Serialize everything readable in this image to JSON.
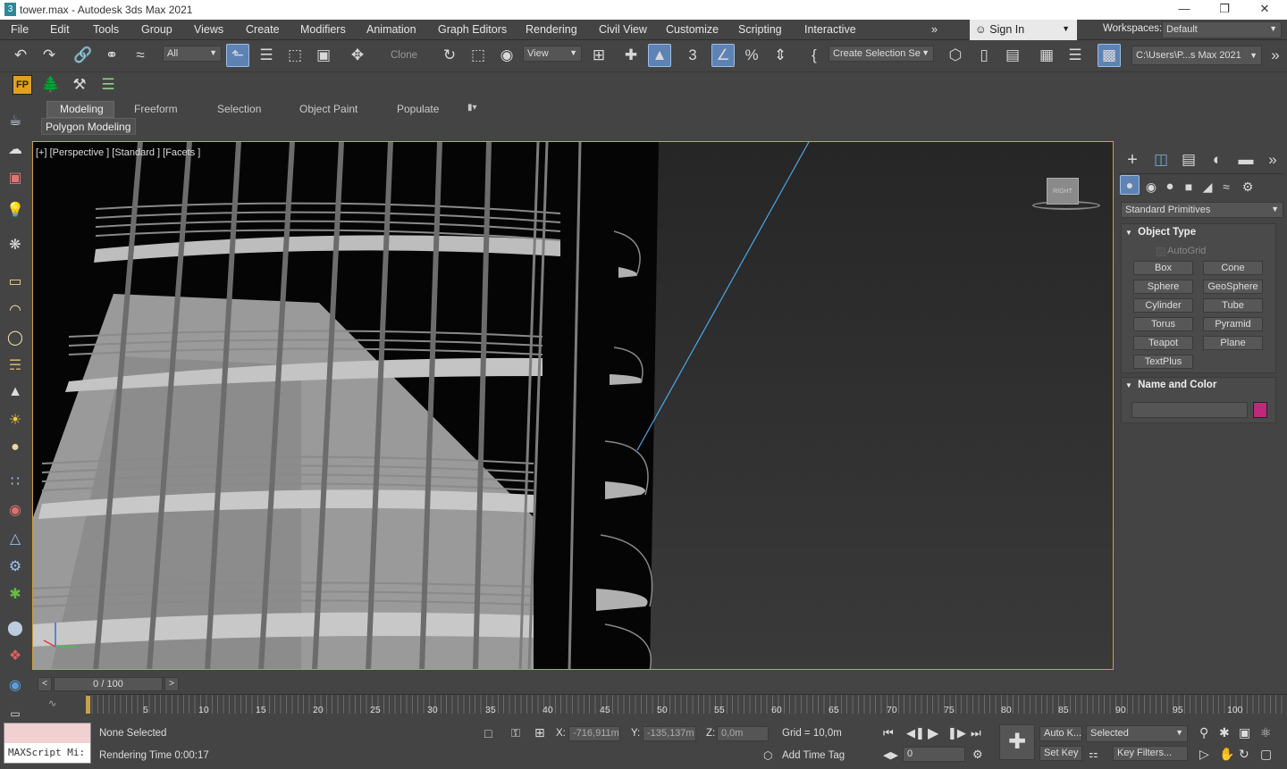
{
  "window": {
    "title": "tower.max - Autodesk 3ds Max 2021"
  },
  "menu": [
    "File",
    "Edit",
    "Tools",
    "Group",
    "Views",
    "Create",
    "Modifiers",
    "Animation",
    "Graph Editors",
    "Rendering",
    "Civil View",
    "Customize",
    "Scripting",
    "Interactive"
  ],
  "account": {
    "sign_in": "Sign In",
    "workspaces_label": "Workspaces:",
    "workspace": "Default"
  },
  "toolbar": {
    "filter": "All",
    "clone": "Clone",
    "ref_coord": "View",
    "selection_set": "Create Selection Se",
    "project_path": "C:\\Users\\P...s Max 2021"
  },
  "ribbon": {
    "tabs": [
      "Modeling",
      "Freeform",
      "Selection",
      "Object Paint",
      "Populate"
    ],
    "sub_label": "Polygon Modeling"
  },
  "viewport": {
    "label": "[+] [Perspective ] [Standard ] [Facets ]",
    "viewcube_face": "RIGHT"
  },
  "command_panel": {
    "category": "Standard Primitives",
    "object_type_title": "Object Type",
    "autogrid": "AutoGrid",
    "buttons": [
      "Box",
      "Cone",
      "Sphere",
      "GeoSphere",
      "Cylinder",
      "Tube",
      "Torus",
      "Pyramid",
      "Teapot",
      "Plane",
      "TextPlus"
    ],
    "name_color_title": "Name and Color",
    "object_color": "#c0287a"
  },
  "timeline": {
    "frame": "0 / 100",
    "ticks": [
      "5",
      "10",
      "15",
      "20",
      "25",
      "30",
      "35",
      "40",
      "45",
      "50",
      "55",
      "60",
      "65",
      "70",
      "75",
      "80",
      "85",
      "90",
      "95",
      "100"
    ]
  },
  "status": {
    "maxscript": "MAXScript Mi:",
    "selection": "None Selected",
    "render_time": "Rendering Time  0:00:17",
    "x_label": "X:",
    "x": "-716,911m",
    "y_label": "Y:",
    "y": "-135,137m",
    "z_label": "Z:",
    "z": "0,0m",
    "grid": "Grid = 10,0m",
    "add_time_tag": "Add Time Tag",
    "auto_key": "Auto K...",
    "set_key": "Set Key",
    "selected": "Selected",
    "key_filters": "Key Filters...",
    "frame_input": "0"
  }
}
